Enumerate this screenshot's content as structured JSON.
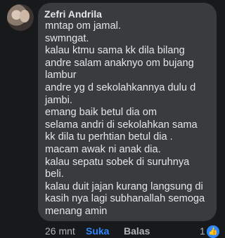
{
  "comment": {
    "author": "Zefri Andrila",
    "lines": [
      "mntap om jamal.",
      "swmngat.",
      "kalau ktmu sama kk dila bilang",
      "andre salam anaknyo om bujang",
      "lambur",
      "andre yg d sekolahkannya dulu d",
      "jambi.",
      "emang baik betul dia om",
      "selama andri di sekolahkan sama",
      "kk dila tu perhtian betul dia .",
      "macam awak ni anak dia.",
      "kalau sepatu sobek di suruhnya",
      "beli.",
      "kalau duit jajan kurang langsung di",
      "kasih nya lagi subhanallah semoga",
      "menang amin"
    ]
  },
  "actions": {
    "time": "26 mnt",
    "like": "Suka",
    "reply": "Balas",
    "reaction_count": "1",
    "reaction_icon": "like-icon"
  }
}
